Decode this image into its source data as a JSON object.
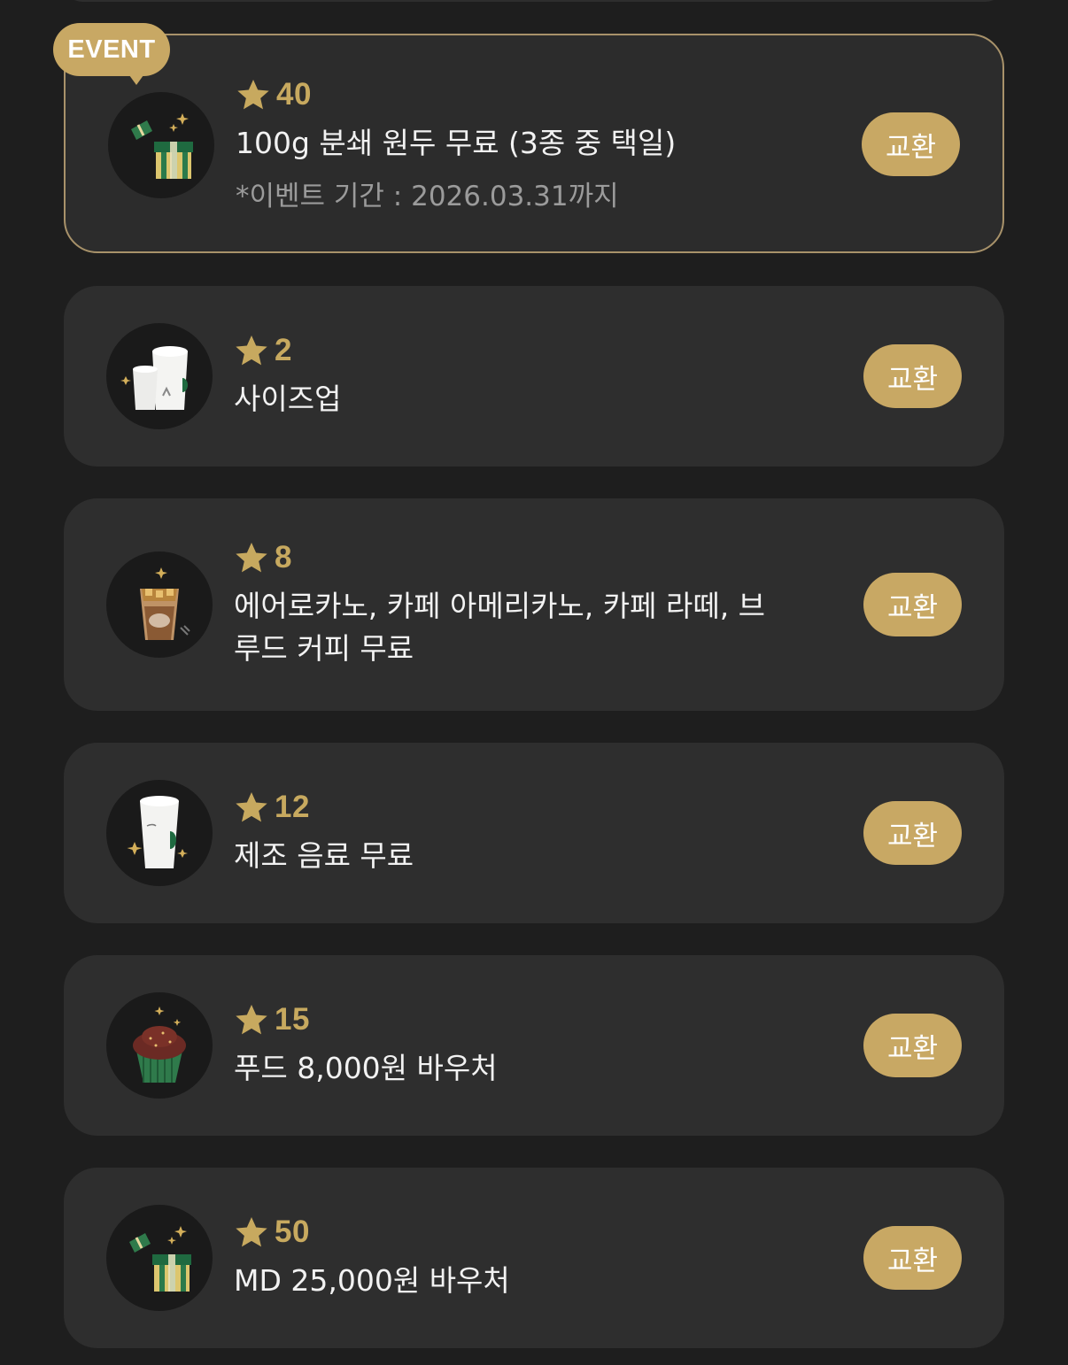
{
  "event_badge": "EVENT",
  "rewards": [
    {
      "stars": "40",
      "title": "100g 분쇄 원두 무료 (3종 중 택일)",
      "sub": "*이벤트 기간 : 2026.03.31까지",
      "button": "교환",
      "icon": "gift-box-icon",
      "event": true
    },
    {
      "stars": "2",
      "title": "사이즈업",
      "button": "교환",
      "icon": "size-up-cups-icon"
    },
    {
      "stars": "8",
      "title_lines": [
        "에어로카노, 카페 아메리카노, 카페 라떼, 브",
        "루드 커피 무료"
      ],
      "button": "교환",
      "icon": "iced-coffee-icon"
    },
    {
      "stars": "12",
      "title": "제조 음료 무료",
      "button": "교환",
      "icon": "drink-cup-icon"
    },
    {
      "stars": "15",
      "title": "푸드 8,000원 바우처",
      "button": "교환",
      "icon": "cupcake-icon"
    },
    {
      "stars": "50",
      "title": "MD 25,000원 바우처",
      "button": "교환",
      "icon": "gift-box-icon"
    }
  ],
  "colors": {
    "accent": "#c8a864",
    "card": "#2e2e2e",
    "background": "#1e1e1e"
  }
}
